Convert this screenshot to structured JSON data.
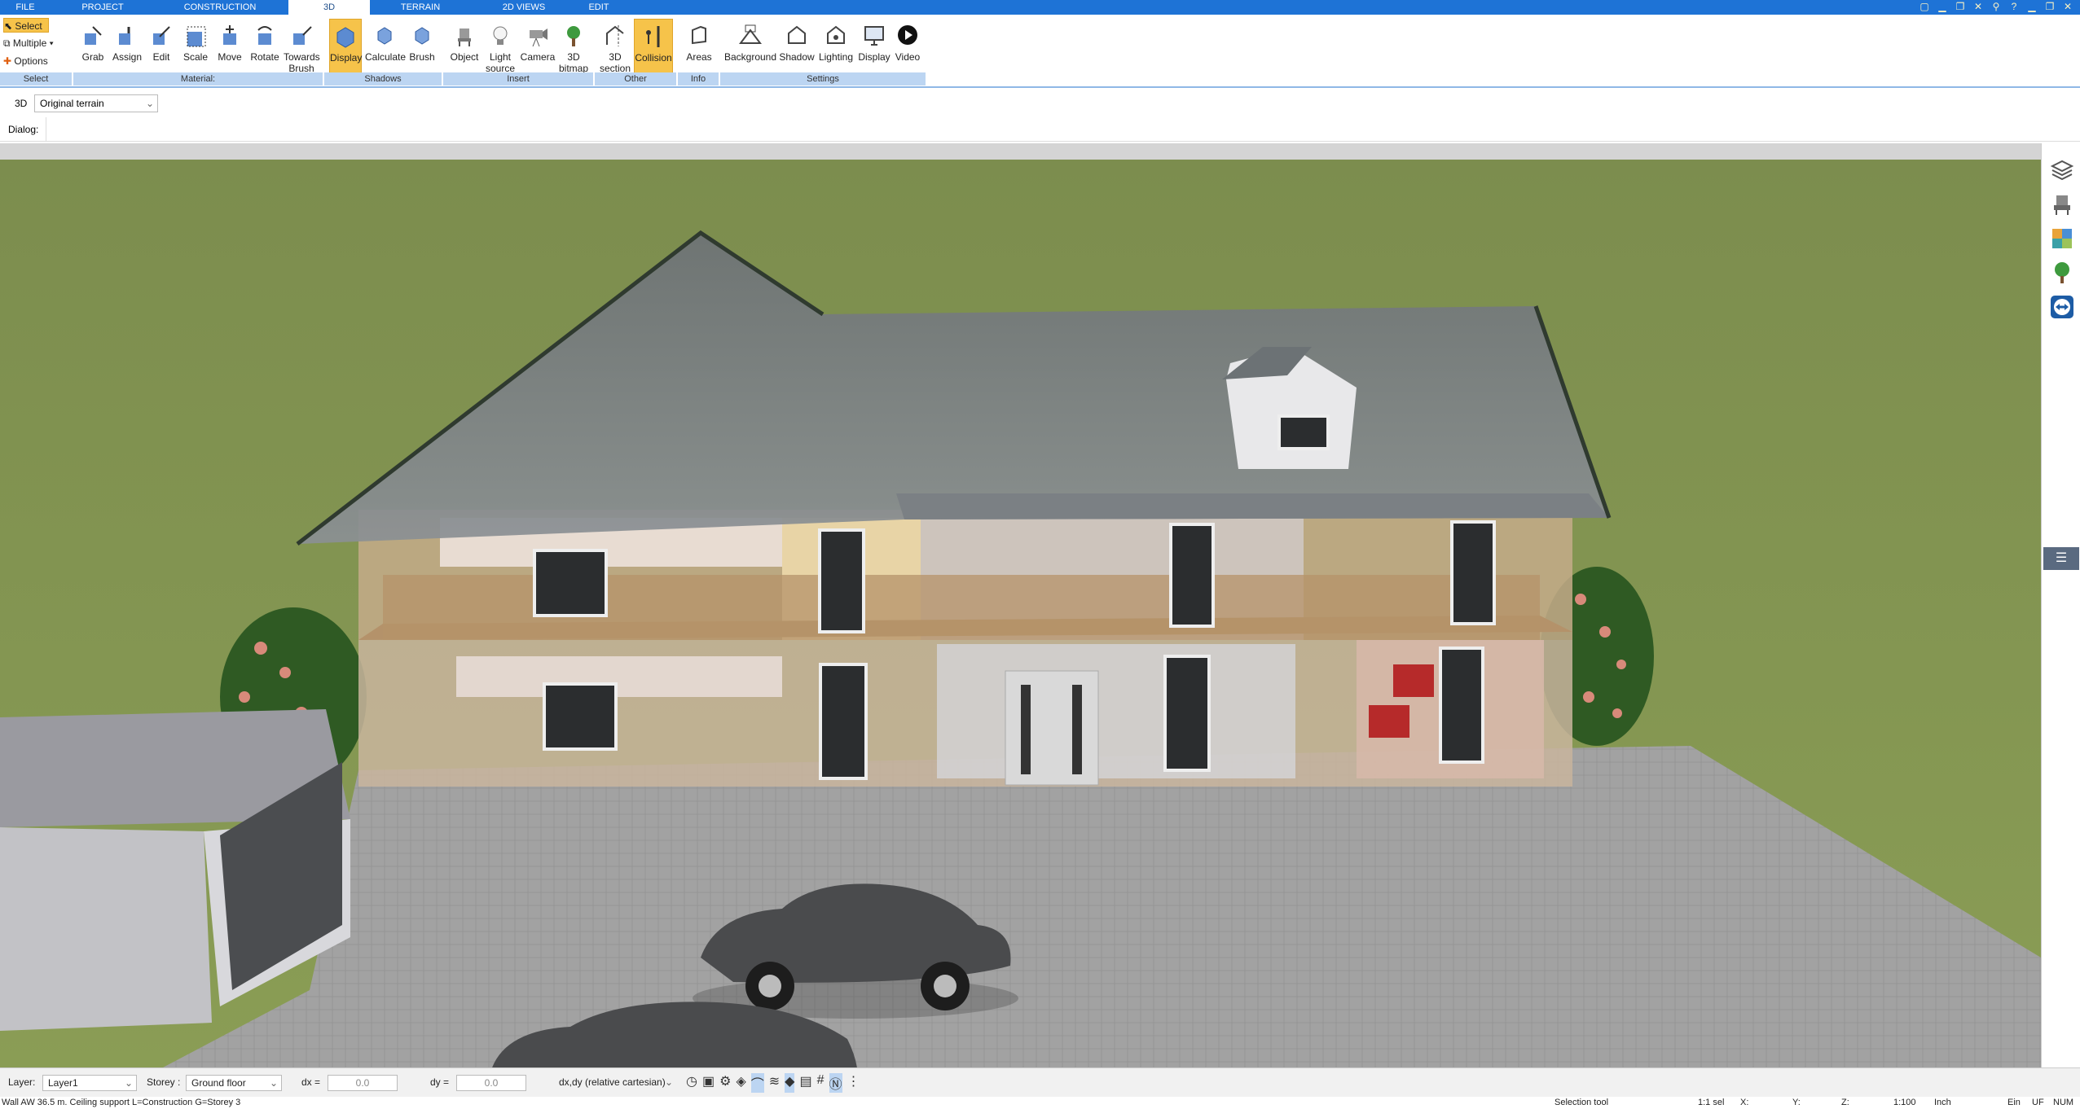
{
  "menu": {
    "tabs": [
      "FILE",
      "PROJECT",
      "CONSTRUCTION",
      "3D",
      "TERRAIN",
      "2D VIEWS",
      "EDIT"
    ],
    "active_tab": "3D"
  },
  "ribbon": {
    "select_group": {
      "select": "Select",
      "multiple": "Multiple",
      "options": "Options",
      "group_label": "Select"
    },
    "material_group": {
      "items": [
        "Grab",
        "Assign",
        "Edit",
        "Scale",
        "Move",
        "Rotate",
        "Towards Brush"
      ],
      "group_label": "Material:"
    },
    "shadows_group": {
      "items": [
        "Display",
        "Calculate",
        "Brush"
      ],
      "group_label": "Shadows"
    },
    "insert_group": {
      "items": [
        "Object",
        "Light source",
        "Camera",
        "3D bitmap"
      ],
      "group_label": "Insert"
    },
    "other_group": {
      "items": [
        "3D section",
        "Collision"
      ],
      "group_label": "Other"
    },
    "info_group": {
      "items": [
        "Areas"
      ],
      "group_label": "Info"
    },
    "settings_group": {
      "items": [
        "Background",
        "Shadow",
        "Lighting",
        "Display",
        "Video"
      ],
      "group_label": "Settings"
    }
  },
  "view_row": {
    "mode": "3D",
    "terrain_select": "Original terrain"
  },
  "dialog_row": {
    "label": "Dialog:"
  },
  "statusbar": {
    "layer_label": "Layer:",
    "layer_value": "Layer1",
    "storey_label": "Storey :",
    "storey_value": "Ground floor",
    "dx_label": "dx =",
    "dx_value": "0.0",
    "dy_label": "dy =",
    "dy_value": "0.0",
    "coord_mode": "dx,dy (relative cartesian)"
  },
  "infobar": {
    "message": "Wall AW 36.5 m. Ceiling support L=Construction G=Storey 3",
    "tool": "Selection tool",
    "sel": "1:1 sel",
    "x": "X:",
    "y": "Y:",
    "z": "Z:",
    "scale": "1:100",
    "unit": "Inch",
    "ein": "Ein",
    "uf": "UF",
    "num": "NUM"
  },
  "colors": {
    "menubar": "#1e73d6",
    "ribbon_group": "#bcd5f2",
    "active_button": "#f6c34a",
    "grass": "#7e8f52",
    "roof": "#7d8285",
    "driveway": "#9c9c9c"
  }
}
